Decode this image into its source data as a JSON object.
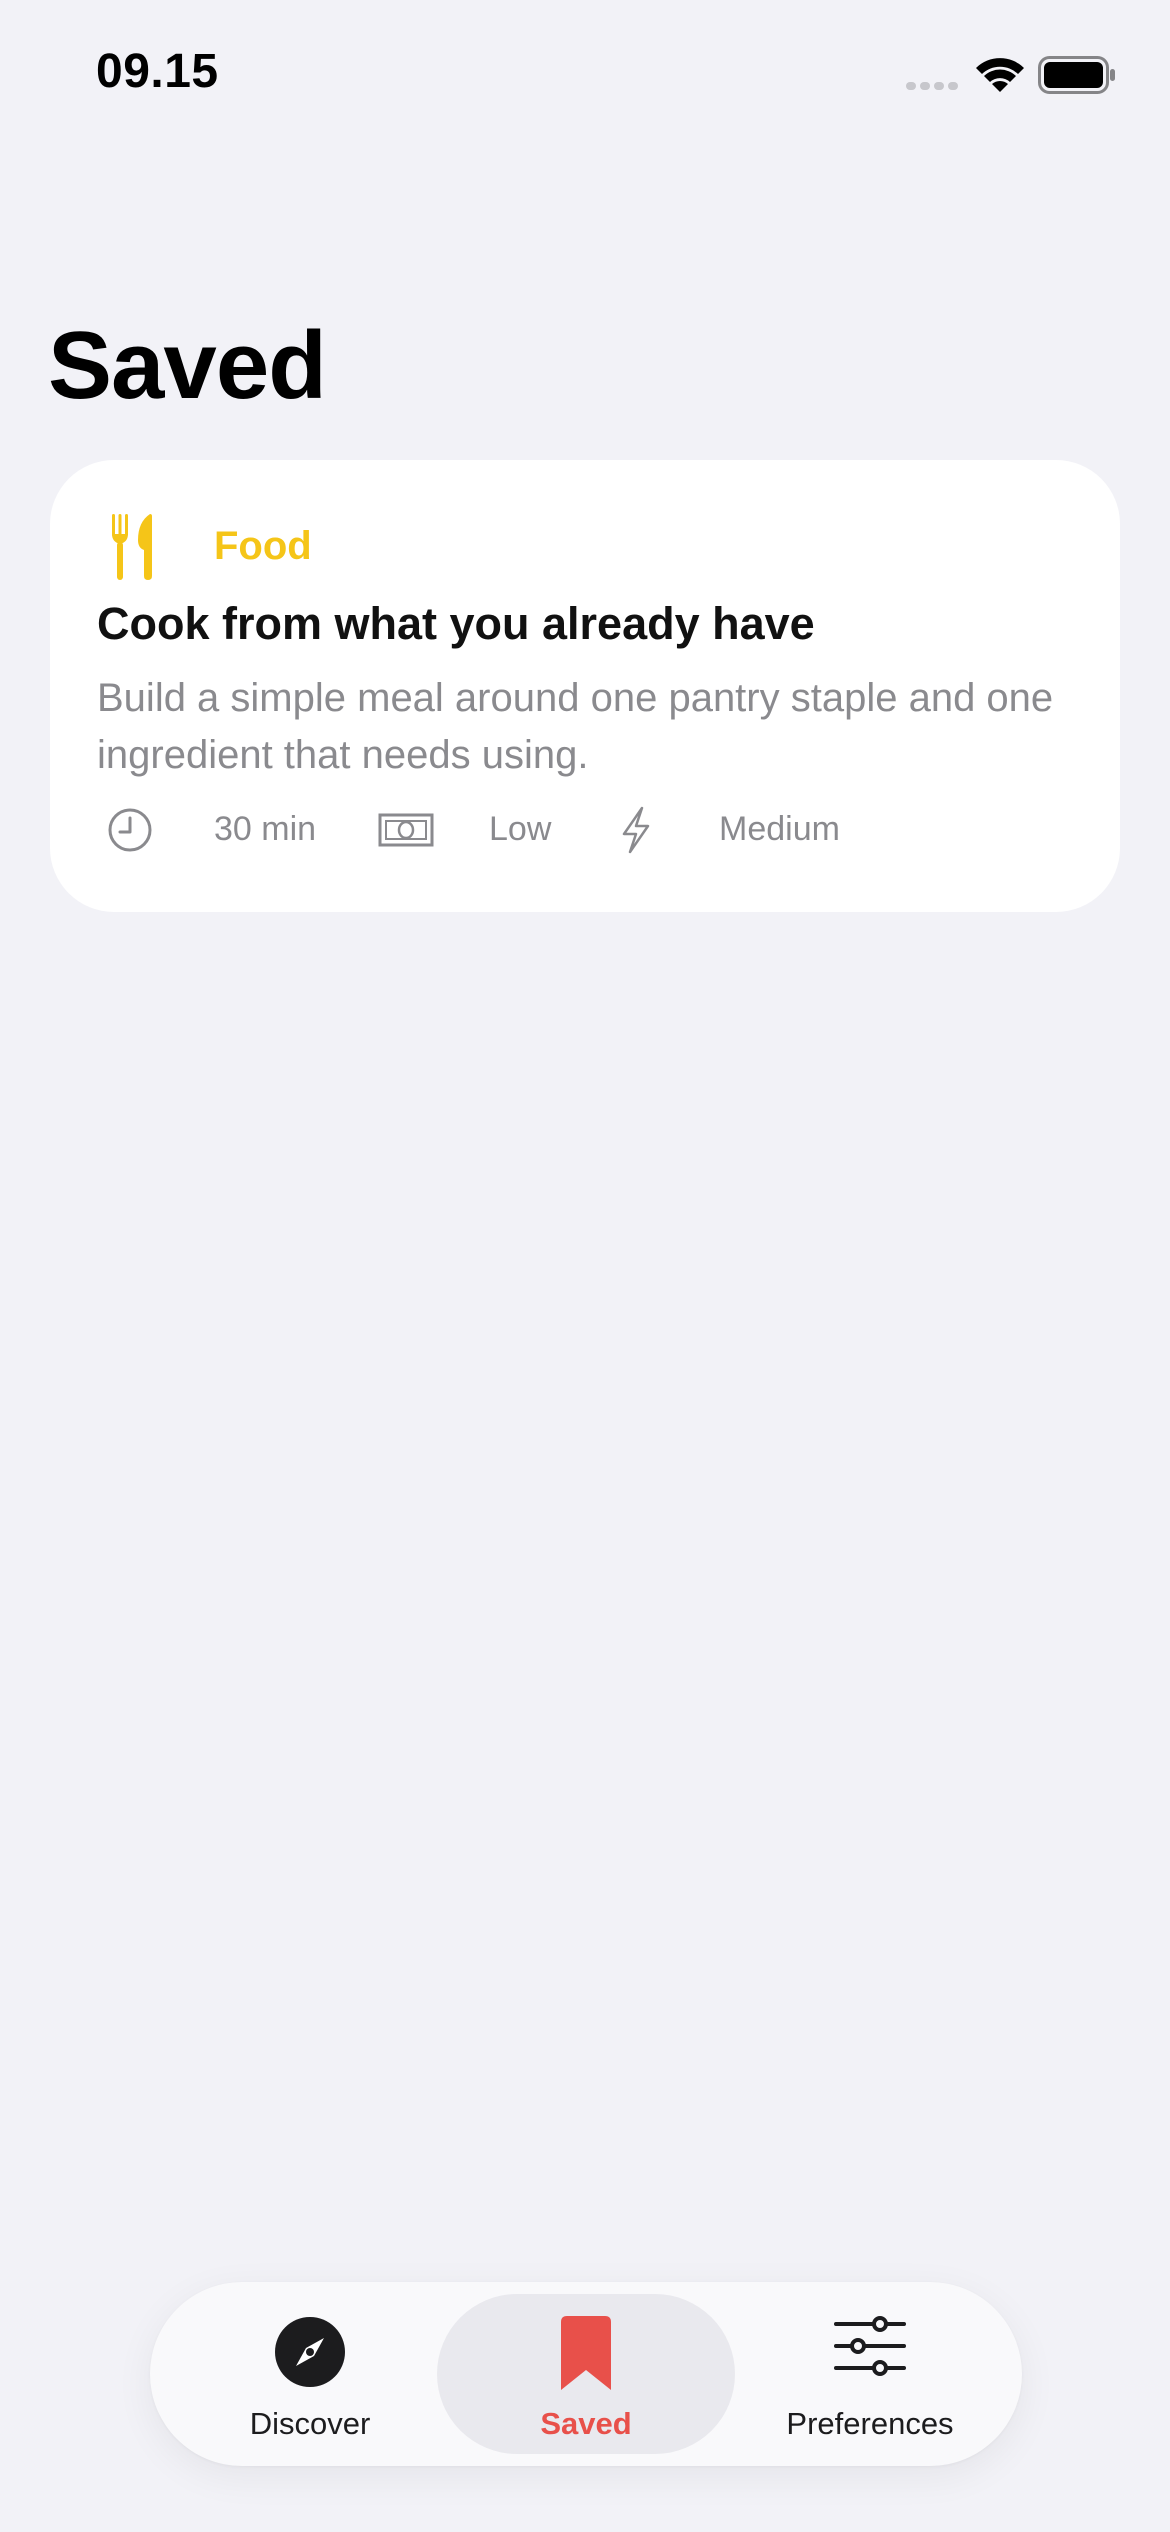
{
  "status_bar": {
    "time": "09.15",
    "icons": [
      "cellular-signal-icon",
      "wifi-icon",
      "battery-icon"
    ]
  },
  "page": {
    "title": "Saved"
  },
  "saved_items": [
    {
      "category": "Food",
      "category_icon": "fork-knife-icon",
      "title": "Cook from what you already have",
      "description": "Build a simple meal around one pantry staple and one ingredient that needs using.",
      "meta": {
        "time": "30 min",
        "time_icon": "clock-icon",
        "cost": "Low",
        "cost_icon": "banknote-icon",
        "energy": "Medium",
        "energy_icon": "bolt-icon"
      }
    }
  ],
  "tab_bar": {
    "tabs": [
      {
        "label": "Discover",
        "icon": "compass-icon",
        "active": false
      },
      {
        "label": "Saved",
        "icon": "bookmark-icon",
        "active": true
      },
      {
        "label": "Preferences",
        "icon": "sliders-icon",
        "active": false
      }
    ]
  },
  "colors": {
    "background": "#f2f2f7",
    "card": "#ffffff",
    "food_accent": "#f5c518",
    "active_tab": "#e8504a",
    "secondary_text": "#8a8a8e"
  }
}
